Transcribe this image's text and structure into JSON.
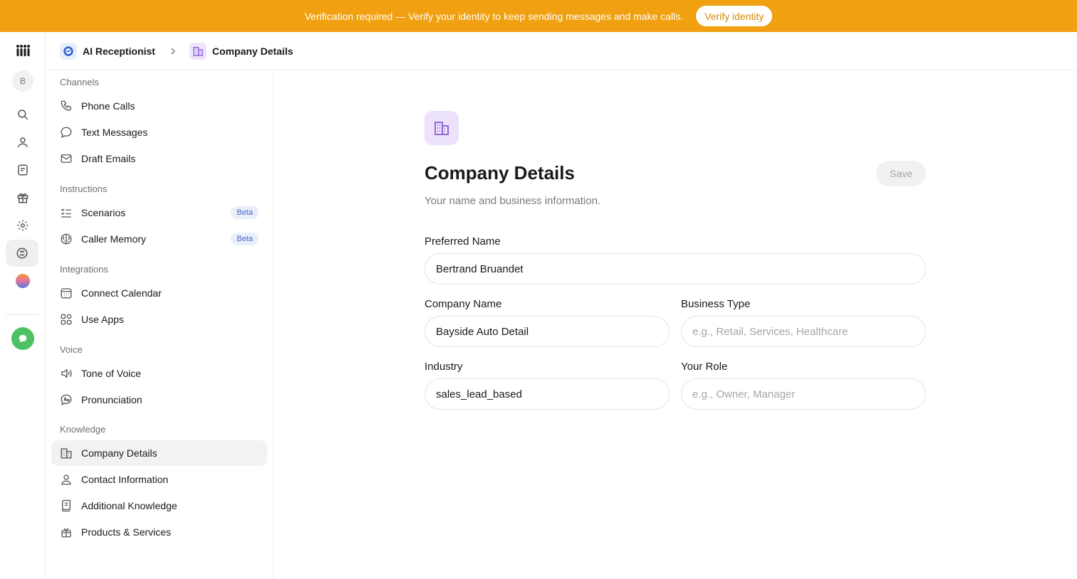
{
  "banner": {
    "text": "Verification required — Verify your identity to keep sending messages and make calls.",
    "button": "Verify identity"
  },
  "rail": {
    "avatar_initial": "B"
  },
  "breadcrumb": {
    "root": "AI Receptionist",
    "current": "Company Details"
  },
  "sidebar": {
    "sections": [
      {
        "label": "Channels",
        "items": [
          {
            "label": "Phone Calls",
            "icon": "phone-icon"
          },
          {
            "label": "Text Messages",
            "icon": "chat-bubble-icon"
          },
          {
            "label": "Draft Emails",
            "icon": "mail-icon"
          }
        ]
      },
      {
        "label": "Instructions",
        "items": [
          {
            "label": "Scenarios",
            "icon": "checklist-icon",
            "badge": "Beta"
          },
          {
            "label": "Caller Memory",
            "icon": "brain-icon",
            "badge": "Beta"
          }
        ]
      },
      {
        "label": "Integrations",
        "items": [
          {
            "label": "Connect Calendar",
            "icon": "calendar-icon"
          },
          {
            "label": "Use Apps",
            "icon": "apps-grid-icon"
          }
        ]
      },
      {
        "label": "Voice",
        "items": [
          {
            "label": "Tone of Voice",
            "icon": "speaker-icon"
          },
          {
            "label": "Pronunciation",
            "icon": "pronunciation-icon"
          }
        ]
      },
      {
        "label": "Knowledge",
        "items": [
          {
            "label": "Company Details",
            "icon": "building-icon",
            "active": true
          },
          {
            "label": "Contact Information",
            "icon": "person-icon"
          },
          {
            "label": "Additional Knowledge",
            "icon": "book-icon"
          },
          {
            "label": "Products & Services",
            "icon": "gift-box-icon"
          }
        ]
      }
    ]
  },
  "main": {
    "title": "Company Details",
    "subtitle": "Your name and business information.",
    "save_label": "Save",
    "fields": {
      "preferred_name": {
        "label": "Preferred Name",
        "value": "Bertrand Bruandet"
      },
      "company_name": {
        "label": "Company Name",
        "value": "Bayside Auto Detail"
      },
      "business_type": {
        "label": "Business Type",
        "value": "",
        "placeholder": "e.g., Retail, Services, Healthcare"
      },
      "industry": {
        "label": "Industry",
        "value": "sales_lead_based"
      },
      "your_role": {
        "label": "Your Role",
        "value": "",
        "placeholder": "e.g., Owner, Manager"
      }
    }
  },
  "colors": {
    "banner": "#f0a010",
    "accent_purple": "#8a5cd6",
    "beta_text": "#4667c9",
    "chat_green": "#4cc264"
  }
}
